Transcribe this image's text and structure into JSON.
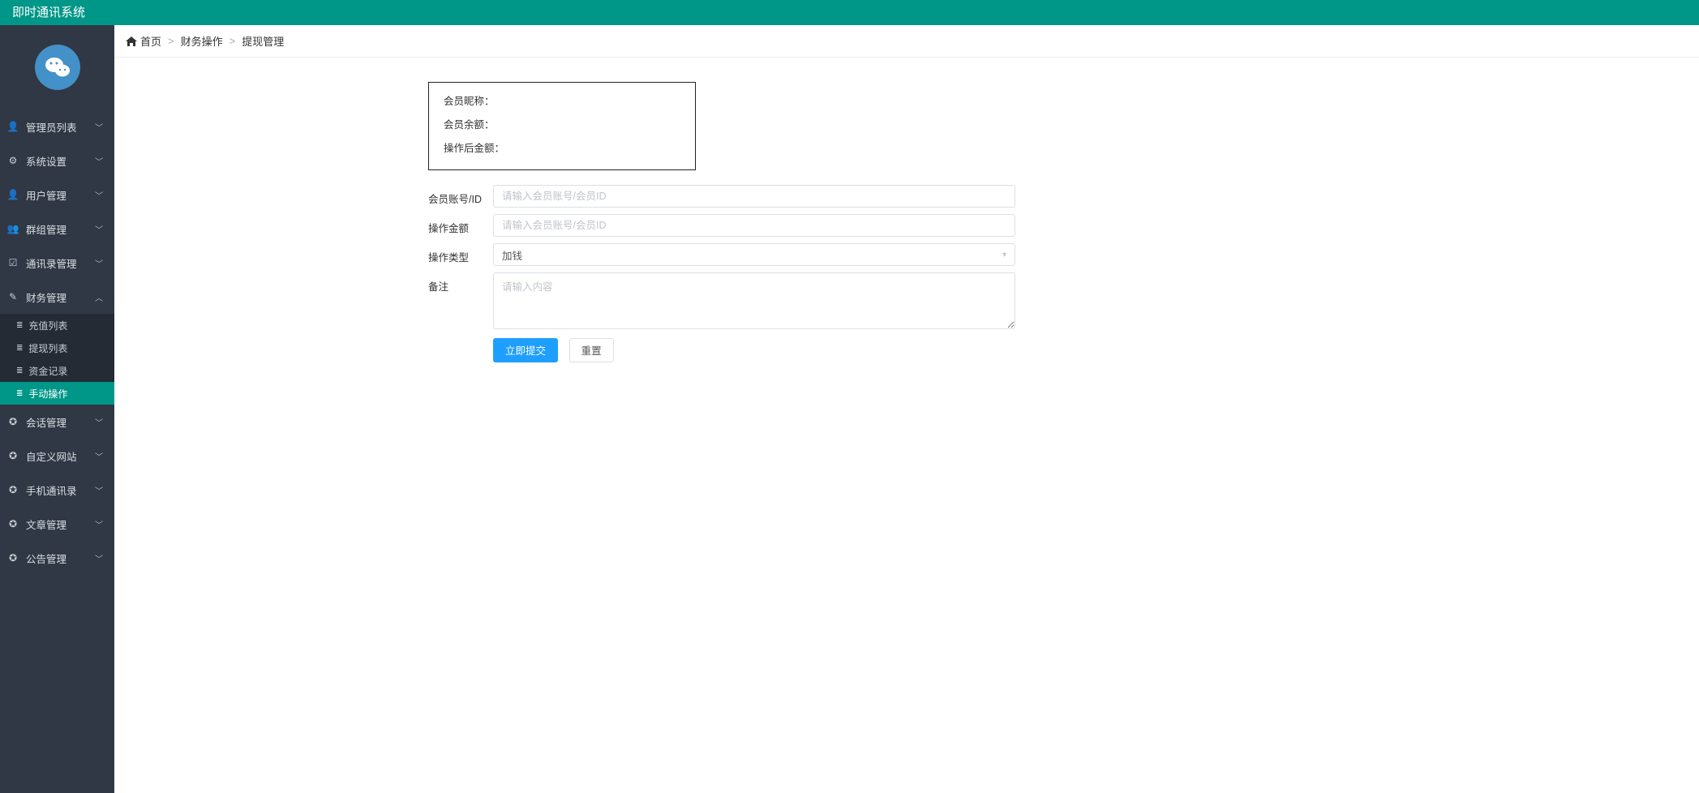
{
  "header": {
    "title": "即时通讯系统"
  },
  "sidebar": {
    "items": [
      {
        "icon": "user",
        "label": "管理员列表",
        "expanded": false
      },
      {
        "icon": "gear",
        "label": "系统设置",
        "expanded": false
      },
      {
        "icon": "user",
        "label": "用户管理",
        "expanded": false
      },
      {
        "icon": "users",
        "label": "群组管理",
        "expanded": false
      },
      {
        "icon": "book",
        "label": "通讯录管理",
        "expanded": false
      },
      {
        "icon": "wallet",
        "label": "财务管理",
        "expanded": true,
        "children": [
          {
            "label": "充值列表",
            "active": false
          },
          {
            "label": "提现列表",
            "active": false
          },
          {
            "label": "资金记录",
            "active": false
          },
          {
            "label": "手动操作",
            "active": true
          }
        ]
      },
      {
        "icon": "chat",
        "label": "会话管理",
        "expanded": false
      },
      {
        "icon": "globe",
        "label": "自定义网站",
        "expanded": false
      },
      {
        "icon": "phone",
        "label": "手机通讯录",
        "expanded": false
      },
      {
        "icon": "doc",
        "label": "文章管理",
        "expanded": false
      },
      {
        "icon": "bell",
        "label": "公告管理",
        "expanded": false
      }
    ]
  },
  "breadcrumb": {
    "home": "首页",
    "mid": "财务操作",
    "last": "提现管理"
  },
  "info": {
    "row1": "会员昵称：",
    "row2": "会员余额：",
    "row3": "操作后金额："
  },
  "form": {
    "account_label": "会员账号/ID",
    "account_placeholder": "请输入会员账号/会员ID",
    "amount_label": "操作金额",
    "amount_placeholder": "请输入会员账号/会员ID",
    "type_label": "操作类型",
    "type_value": "加钱",
    "remark_label": "备注",
    "remark_placeholder": "请输入内容",
    "submit_label": "立即提交",
    "reset_label": "重置"
  },
  "icons": {
    "user": "👤",
    "gear": "⚙",
    "users": "👥",
    "book": "☑",
    "wallet": "✎",
    "chat": "✪",
    "globe": "✪",
    "phone": "✪",
    "doc": "✪",
    "bell": "✪"
  }
}
